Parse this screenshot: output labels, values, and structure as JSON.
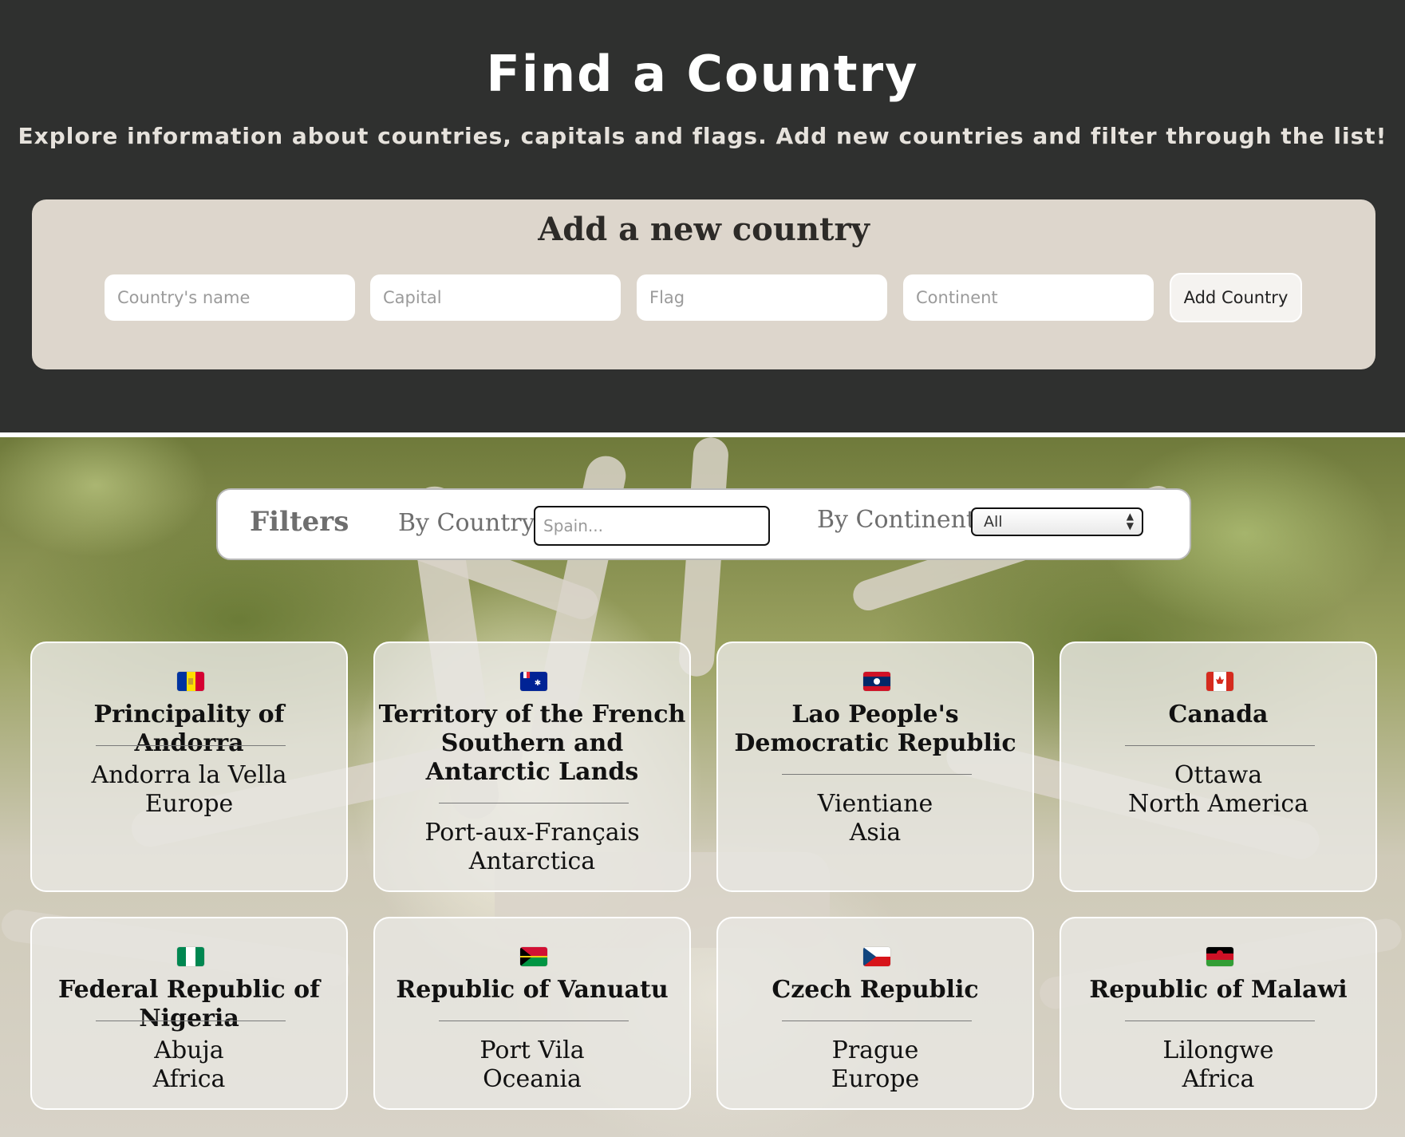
{
  "header": {
    "title": "Find a Country",
    "subtitle": "Explore information about countries, capitals and flags. Add new countries and filter through the list!"
  },
  "add_form": {
    "title": "Add a new country",
    "name_placeholder": "Country's name",
    "capital_placeholder": "Capital",
    "flag_placeholder": "Flag",
    "continent_placeholder": "Continent",
    "button_label": "Add Country"
  },
  "filters": {
    "title": "Filters",
    "by_country_label": "By Country",
    "country_placeholder": "Spain...",
    "by_continent_label": "By Continent",
    "continent_selected": "All"
  },
  "countries": [
    {
      "name": "Principality of Andorra",
      "capital": "Andorra la Vella",
      "continent": "Europe",
      "flag": "andorra-flag-icon"
    },
    {
      "name": "Territory of the French Southern and Antarctic Lands",
      "capital": "Port-aux-Français",
      "continent": "Antarctica",
      "flag": "french-southern-lands-flag-icon"
    },
    {
      "name": "Lao People's Democratic Republic",
      "capital": "Vientiane",
      "continent": "Asia",
      "flag": "laos-flag-icon"
    },
    {
      "name": "Canada",
      "capital": "Ottawa",
      "continent": "North America",
      "flag": "canada-flag-icon"
    },
    {
      "name": "Federal Republic of Nigeria",
      "capital": "Abuja",
      "continent": "Africa",
      "flag": "nigeria-flag-icon"
    },
    {
      "name": "Republic of Vanuatu",
      "capital": "Port Vila",
      "continent": "Oceania",
      "flag": "vanuatu-flag-icon"
    },
    {
      "name": "Czech Republic",
      "capital": "Prague",
      "continent": "Europe",
      "flag": "czech-flag-icon"
    },
    {
      "name": "Republic of Malawi",
      "capital": "Lilongwe",
      "continent": "Africa",
      "flag": "malawi-flag-icon"
    }
  ],
  "colors": {
    "header_bg": "#2f302f",
    "panel_bg": "#ddd6cc",
    "card_bg": "#e8e6e2"
  }
}
